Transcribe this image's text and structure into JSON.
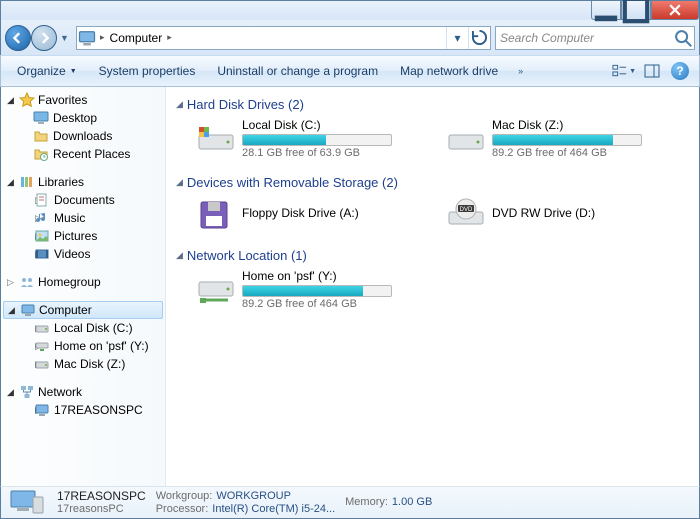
{
  "window": {
    "minimize": "–",
    "maximize": "▢",
    "close": "×"
  },
  "nav": {
    "location": "Computer",
    "search_placeholder": "Search Computer"
  },
  "cmdbar": {
    "organize": "Organize",
    "sysprops": "System properties",
    "uninstall": "Uninstall or change a program",
    "mapdrive": "Map network drive"
  },
  "sidebar": {
    "favorites": {
      "label": "Favorites",
      "items": [
        "Desktop",
        "Downloads",
        "Recent Places"
      ]
    },
    "libraries": {
      "label": "Libraries",
      "items": [
        "Documents",
        "Music",
        "Pictures",
        "Videos"
      ]
    },
    "homegroup": {
      "label": "Homegroup"
    },
    "computer": {
      "label": "Computer",
      "items": [
        "Local Disk (C:)",
        "Home on 'psf' (Y:)",
        "Mac Disk (Z:)"
      ]
    },
    "network": {
      "label": "Network",
      "items": [
        "17REASONSPC"
      ]
    }
  },
  "sections": {
    "hdd": {
      "title": "Hard Disk Drives (2)",
      "drives": [
        {
          "name": "Local Disk (C:)",
          "free": "28.1 GB free of 63.9 GB",
          "fill": 56
        },
        {
          "name": "Mac Disk (Z:)",
          "free": "89.2 GB free of 464 GB",
          "fill": 81
        }
      ]
    },
    "rem": {
      "title": "Devices with Removable Storage (2)",
      "drives": [
        {
          "name": "Floppy Disk Drive (A:)"
        },
        {
          "name": "DVD RW Drive (D:)"
        }
      ]
    },
    "net": {
      "title": "Network Location (1)",
      "drives": [
        {
          "name": "Home on 'psf' (Y:)",
          "free": "89.2 GB free of 464 GB",
          "fill": 81
        }
      ]
    }
  },
  "details": {
    "name": "17REASONSPC",
    "sub": "17reasonsPC",
    "workgroup_k": "Workgroup:",
    "workgroup_v": "WORKGROUP",
    "processor_k": "Processor:",
    "processor_v": "Intel(R) Core(TM) i5-24...",
    "memory_k": "Memory:",
    "memory_v": "1.00 GB"
  }
}
